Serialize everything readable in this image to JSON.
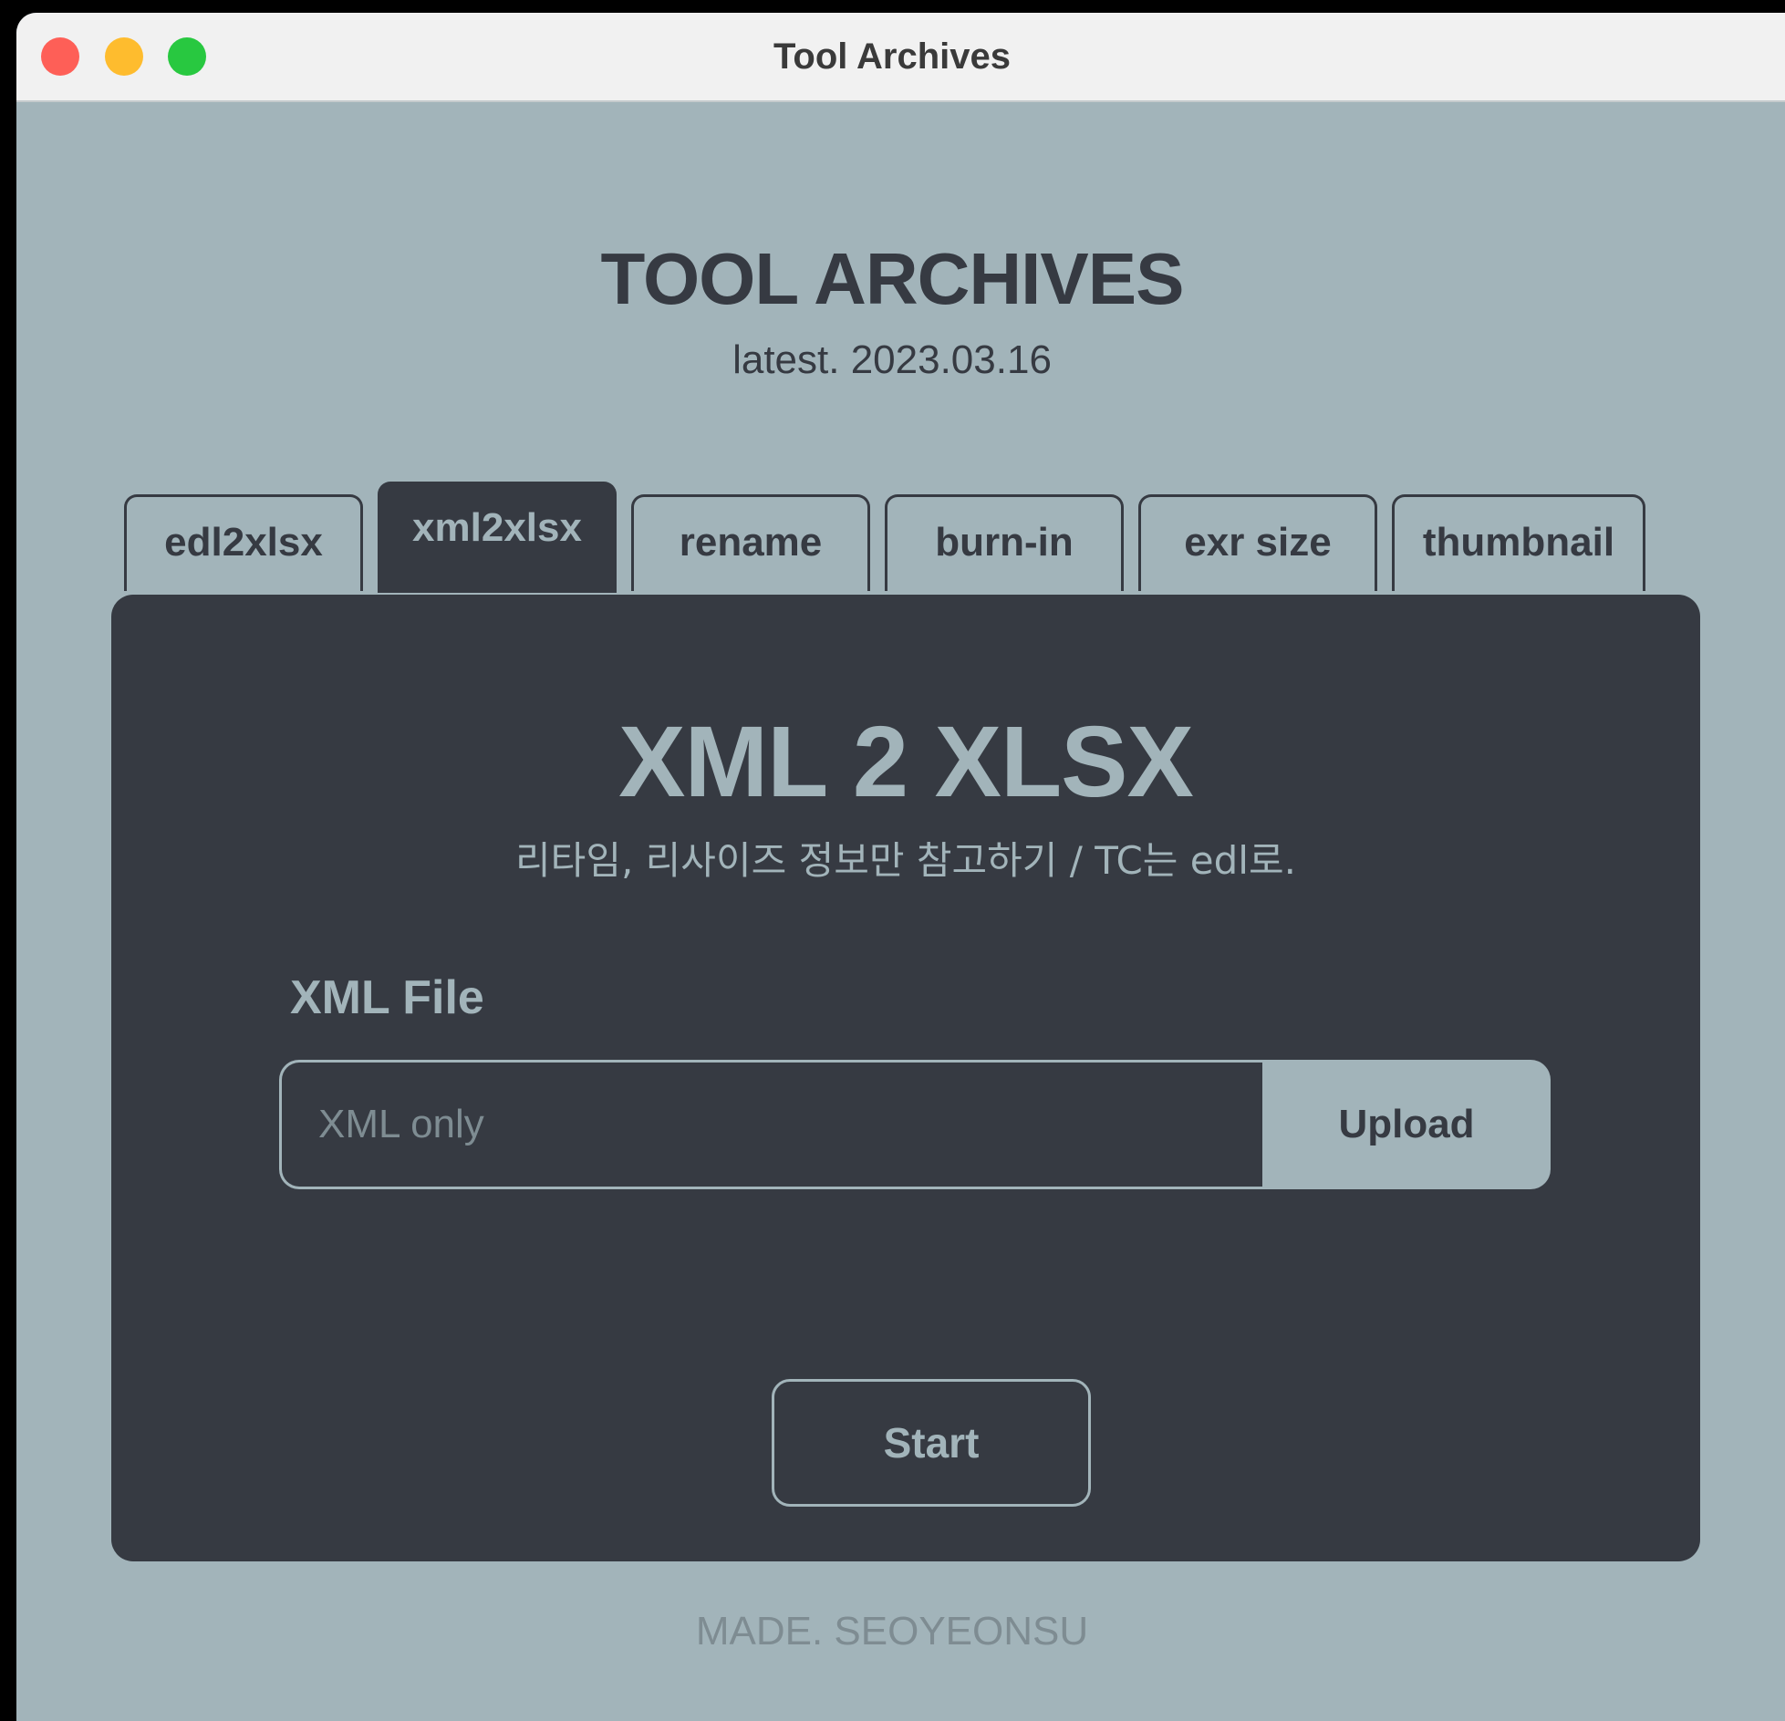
{
  "window": {
    "title": "Tool Archives"
  },
  "header": {
    "title": "TOOL ARCHIVES",
    "version": "latest. 2023.03.16"
  },
  "tabs": [
    {
      "label": "edl2xlsx",
      "active": false
    },
    {
      "label": "xml2xlsx",
      "active": true
    },
    {
      "label": "rename",
      "active": false
    },
    {
      "label": "burn-in",
      "active": false
    },
    {
      "label": "exr size",
      "active": false
    },
    {
      "label": "thumbnail",
      "active": false
    }
  ],
  "panel": {
    "title": "XML 2 XLSX",
    "description": "리타임, 리사이즈 정보만 참고하기 / TC는 edl로.",
    "field_label": "XML File",
    "file_input": {
      "value": "",
      "placeholder": "XML only"
    },
    "upload_label": "Upload",
    "start_label": "Start"
  },
  "footer": {
    "text": "MADE. SEOYEONSU"
  },
  "colors": {
    "background": "#a2b4ba",
    "panel": "#363a42",
    "text_dark": "#363a42",
    "text_light": "#a2b4ba",
    "muted": "#7e8c92",
    "traffic_close": "#fe5f57",
    "traffic_minimize": "#febc2e",
    "traffic_maximize": "#28c840"
  }
}
